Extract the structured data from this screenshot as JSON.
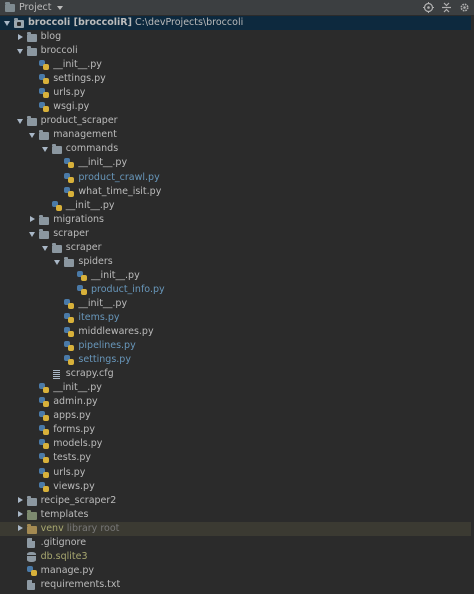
{
  "header": {
    "title": "Project",
    "toolbar_icons": [
      "target-icon",
      "collapse-all-icon",
      "gear-icon"
    ]
  },
  "tree": [
    {
      "depth": 0,
      "type": "folder-module",
      "open": true,
      "label": "broccoli [broccoliR]",
      "suffix": "C:\\devProjects\\broccoli",
      "bold": true
    },
    {
      "depth": 1,
      "type": "folder",
      "open": false,
      "label": "blog"
    },
    {
      "depth": 1,
      "type": "folder",
      "open": true,
      "label": "broccoli"
    },
    {
      "depth": 2,
      "type": "py",
      "label": "__init__.py"
    },
    {
      "depth": 2,
      "type": "py",
      "label": "settings.py"
    },
    {
      "depth": 2,
      "type": "py",
      "label": "urls.py"
    },
    {
      "depth": 2,
      "type": "py",
      "label": "wsgi.py"
    },
    {
      "depth": 1,
      "type": "folder",
      "open": true,
      "label": "product_scraper"
    },
    {
      "depth": 2,
      "type": "folder",
      "open": true,
      "label": "management"
    },
    {
      "depth": 3,
      "type": "folder",
      "open": true,
      "label": "commands"
    },
    {
      "depth": 4,
      "type": "py",
      "label": "__init__.py"
    },
    {
      "depth": 4,
      "type": "py",
      "label": "product_crawl.py",
      "color": "blue"
    },
    {
      "depth": 4,
      "type": "py",
      "label": "what_time_isit.py"
    },
    {
      "depth": 3,
      "type": "py",
      "label": "__init__.py"
    },
    {
      "depth": 2,
      "type": "folder",
      "open": false,
      "label": "migrations"
    },
    {
      "depth": 2,
      "type": "folder",
      "open": true,
      "label": "scraper"
    },
    {
      "depth": 3,
      "type": "folder",
      "open": true,
      "label": "scraper"
    },
    {
      "depth": 4,
      "type": "folder",
      "open": true,
      "label": "spiders"
    },
    {
      "depth": 5,
      "type": "py",
      "label": "__init__.py"
    },
    {
      "depth": 5,
      "type": "py",
      "label": "product_info.py",
      "color": "blue"
    },
    {
      "depth": 4,
      "type": "py",
      "label": "__init__.py"
    },
    {
      "depth": 4,
      "type": "py",
      "label": "items.py",
      "color": "blue"
    },
    {
      "depth": 4,
      "type": "py",
      "label": "middlewares.py"
    },
    {
      "depth": 4,
      "type": "py",
      "label": "pipelines.py",
      "color": "blue"
    },
    {
      "depth": 4,
      "type": "py",
      "label": "settings.py",
      "color": "blue"
    },
    {
      "depth": 3,
      "type": "cfg",
      "label": "scrapy.cfg"
    },
    {
      "depth": 2,
      "type": "py",
      "label": "__init__.py"
    },
    {
      "depth": 2,
      "type": "py",
      "label": "admin.py"
    },
    {
      "depth": 2,
      "type": "py",
      "label": "apps.py"
    },
    {
      "depth": 2,
      "type": "py",
      "label": "forms.py"
    },
    {
      "depth": 2,
      "type": "py",
      "label": "models.py"
    },
    {
      "depth": 2,
      "type": "py",
      "label": "tests.py"
    },
    {
      "depth": 2,
      "type": "py",
      "label": "urls.py"
    },
    {
      "depth": 2,
      "type": "py",
      "label": "views.py"
    },
    {
      "depth": 1,
      "type": "folder",
      "open": false,
      "label": "recipe_scraper2"
    },
    {
      "depth": 1,
      "type": "folder-template",
      "open": false,
      "label": "templates"
    },
    {
      "depth": 1,
      "type": "folder-venv",
      "open": false,
      "label": "venv",
      "suffix": "library root",
      "color": "olive",
      "highlight": true
    },
    {
      "depth": 1,
      "type": "file",
      "label": ".gitignore"
    },
    {
      "depth": 1,
      "type": "db",
      "label": "db.sqlite3",
      "color": "olive"
    },
    {
      "depth": 1,
      "type": "py",
      "label": "manage.py"
    },
    {
      "depth": 1,
      "type": "file",
      "label": "requirements.txt"
    }
  ]
}
